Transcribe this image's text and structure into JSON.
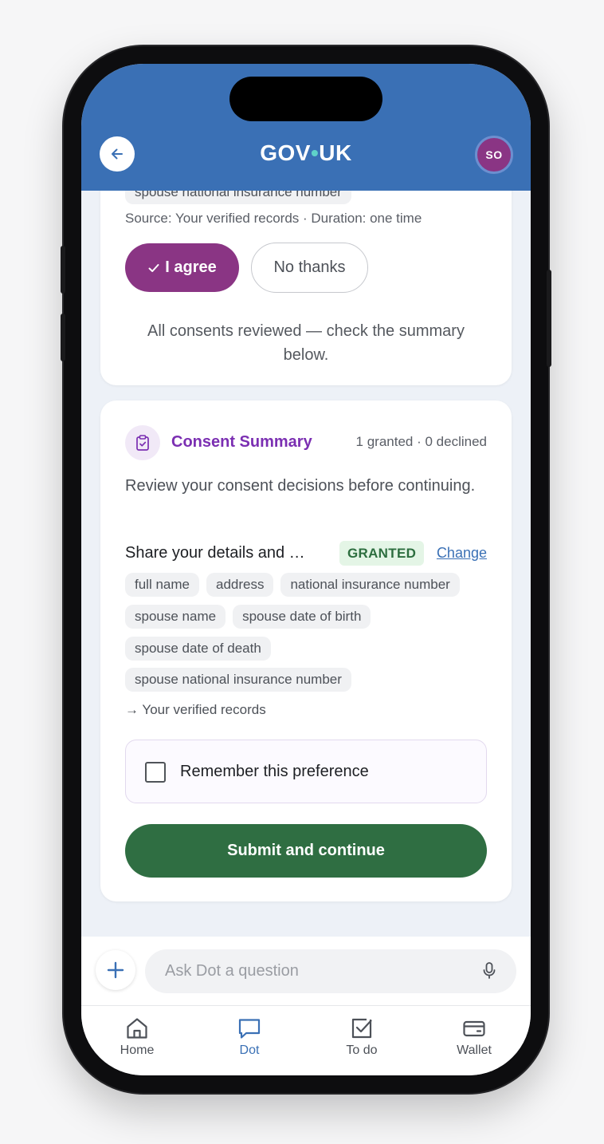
{
  "header": {
    "logo_left": "GOV",
    "logo_dot": "•",
    "logo_right": "UK",
    "avatar_initials": "SO"
  },
  "previous_consent": {
    "cut_chip": "spouse national insurance number",
    "source_line": "Source: Your verified records · Duration: one time",
    "agree_label": "I agree",
    "decline_label": "No thanks",
    "reviewed_text": "All consents reviewed — check the summary below."
  },
  "summary": {
    "title": "Consent Summary",
    "counts": "1 granted · 0 declined",
    "description": "Review your consent decisions before continuing.",
    "item": {
      "title": "Share your details and …",
      "status": "GRANTED",
      "change_label": "Change",
      "chips": [
        [
          "full name",
          "address",
          "national insurance number"
        ],
        [
          "spouse name",
          "spouse date of birth"
        ],
        [
          "spouse date of death"
        ],
        [
          "spouse national insurance number"
        ]
      ],
      "destination": "→ Your verified records"
    },
    "remember_label": "Remember this preference",
    "remember_checked": false,
    "submit_label": "Submit and continue"
  },
  "composer": {
    "placeholder": "Ask Dot a question"
  },
  "tabs": [
    {
      "label": "Home",
      "icon": "home-icon",
      "active": false
    },
    {
      "label": "Dot",
      "icon": "chat-icon",
      "active": true
    },
    {
      "label": "To do",
      "icon": "checkbox-icon",
      "active": false
    },
    {
      "label": "Wallet",
      "icon": "wallet-icon",
      "active": false
    }
  ],
  "colors": {
    "header_blue": "#3a70b5",
    "agree_purple": "#8a3584",
    "summary_purple": "#7b2fb2",
    "granted_green": "#2d6e3f",
    "submit_green": "#2f6e42",
    "active_tab": "#3a70b5"
  }
}
